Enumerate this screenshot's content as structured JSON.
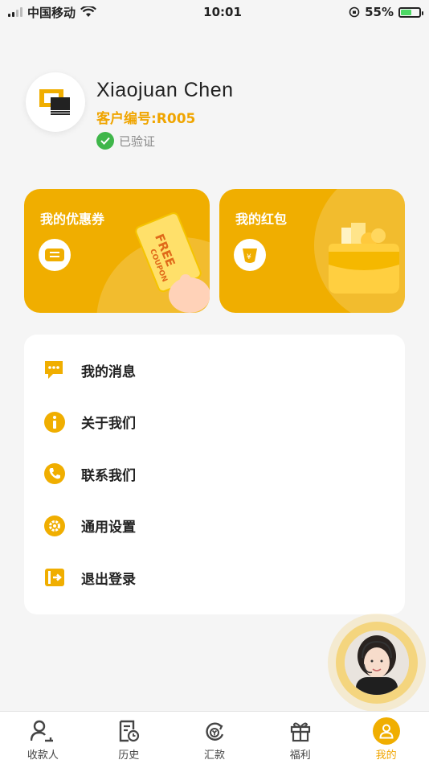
{
  "status_bar": {
    "carrier": "中国移动",
    "time": "10:01",
    "battery": "55%"
  },
  "profile": {
    "name": "Xiaojuan Chen",
    "customer_no": "客户编号:R005",
    "verified": "已验证"
  },
  "cards": {
    "coupon": {
      "title": "我的优惠券"
    },
    "redpacket": {
      "title": "我的红包"
    }
  },
  "menu": {
    "items": [
      {
        "label": "我的消息",
        "icon": "message-icon"
      },
      {
        "label": "关于我们",
        "icon": "info-icon"
      },
      {
        "label": "联系我们",
        "icon": "phone-icon"
      },
      {
        "label": "通用设置",
        "icon": "gear-icon"
      },
      {
        "label": "退出登录",
        "icon": "logout-icon"
      }
    ]
  },
  "tabbar": {
    "items": [
      {
        "label": "收款人",
        "icon": "payee-icon"
      },
      {
        "label": "历史",
        "icon": "history-icon"
      },
      {
        "label": "汇款",
        "icon": "remit-icon"
      },
      {
        "label": "福利",
        "icon": "gift-icon"
      },
      {
        "label": "我的",
        "icon": "user-icon",
        "active": true
      }
    ]
  },
  "colors": {
    "accent": "#f0ae00",
    "verified": "#3fb64a"
  }
}
